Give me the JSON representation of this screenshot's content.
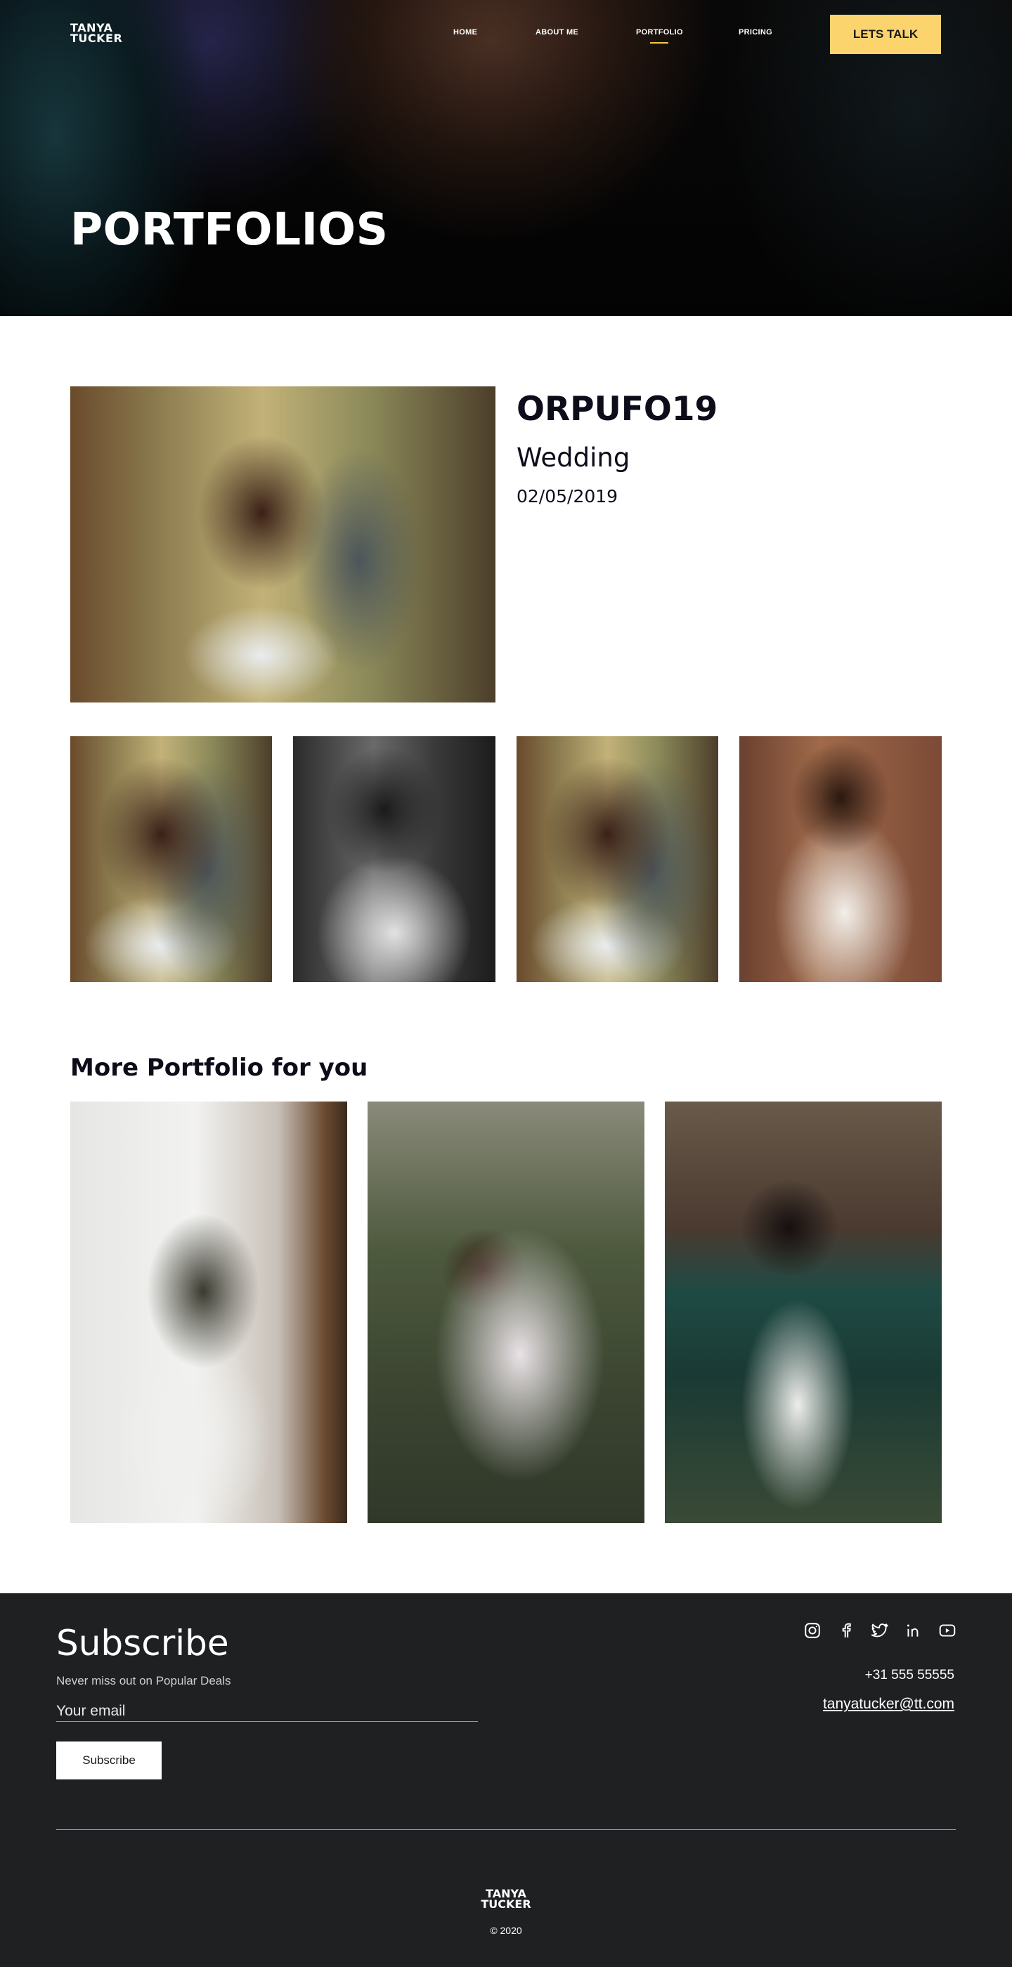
{
  "brand": {
    "logo_line1": "TANYA",
    "logo_line2": "TUCKER"
  },
  "nav": {
    "items": [
      {
        "label": "HOME",
        "active": false
      },
      {
        "label": "ABOUT ME",
        "active": false
      },
      {
        "label": "PORTFOLIO",
        "active": true
      },
      {
        "label": "PRICING",
        "active": false
      }
    ],
    "cta_label": "LETS TALK"
  },
  "hero": {
    "title": "PORTFOLIOS"
  },
  "featured": {
    "code": "ORPUFO19",
    "type": "Wedding",
    "date": "02/05/2019"
  },
  "more": {
    "title": "More Portfolio for you"
  },
  "footer": {
    "subscribe_title": "Subscribe",
    "subscribe_desc": "Never miss out on Popular Deals",
    "email_placeholder": "Your email",
    "subscribe_button": "Subscribe",
    "social": [
      "instagram-icon",
      "facebook-icon",
      "twitter-icon",
      "linkedin-icon",
      "youtube-icon"
    ],
    "phone": "+31 555 55555",
    "email": "tanyatucker@tt.com",
    "copyright": "© 2020"
  },
  "colors": {
    "accent": "#fcd46e",
    "nav_underline": "#f6c844",
    "footer_bg": "#1e2022",
    "divider": "#b9a66a"
  }
}
